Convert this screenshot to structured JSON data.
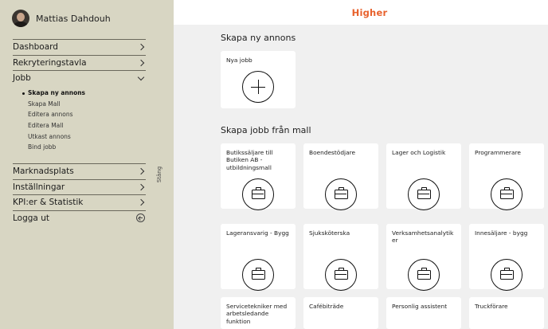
{
  "user": {
    "name": "Mattias Dahdouh"
  },
  "nav": {
    "dashboard": "Dashboard",
    "rekryteringstavla": "Rekryteringstavla",
    "jobb": "Jobb",
    "marknadsplats": "Marknadsplats",
    "installningar": "Inställningar",
    "kpi": "KPI:er & Statistik",
    "logout": "Logga ut"
  },
  "jobb_sub": [
    "Skapa ny annons",
    "Skapa Mall",
    "Editera annons",
    "Editera Mall",
    "Utkast annons",
    "Bind jobb"
  ],
  "close_tab": "Stäng",
  "header": {
    "logo": "Higher"
  },
  "section_new": {
    "title": "Skapa ny annons",
    "card": "Nya jobb"
  },
  "section_templates": {
    "title": "Skapa jobb från mall",
    "cards": [
      "Butikssäljare till Butiken AB - utbildningsmall",
      "Boendestödjare",
      "Lager och Logistik",
      "Programmerare",
      "Lageransvarig - Bygg",
      "Sjuksköterska",
      "Verksamhetsanalytik er",
      "Innesäljare - bygg",
      "Servicetekniker med arbetsledande funktion",
      "Cafébiträde",
      "Personlig assistent",
      "Truckförare"
    ]
  },
  "colors": {
    "sidebar": "#d8d6c3",
    "brand": "#e8612c",
    "main": "#f0f0f0"
  }
}
